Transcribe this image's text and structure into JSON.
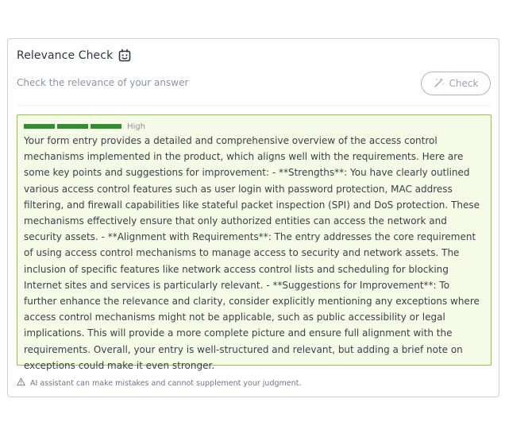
{
  "panel": {
    "title": "Relevance Check",
    "subtitle": "Check the relevance of your answer",
    "check_button_label": "Check"
  },
  "result": {
    "relevance_level": "High",
    "meter": {
      "filled_segments": 3,
      "total_segments": 3,
      "color": "#2f8f2f"
    },
    "text": "Your form entry provides a detailed and comprehensive overview of the access control mechanisms implemented in the product, which aligns well with the requirements. Here are some key points and suggestions for improvement: - **Strengths**: You have clearly outlined various access control features such as user login with password protection, MAC address filtering, and firewall capabilities like stateful packet inspection (SPI) and DoS protection. These mechanisms effectively ensure that only authorized entities can access the network and security assets. - **Alignment with Requirements**: The entry addresses the core requirement of using access control mechanisms to manage access to security and network assets. The inclusion of specific features like network access control lists and scheduling for blocking Internet sites and services is particularly relevant. - **Suggestions for Improvement**: To further enhance the relevance and clarity, consider explicitly mentioning any exceptions where access control mechanisms might not be applicable, such as public accessibility or legal implications. This will provide a more complete picture and ensure full alignment with the requirements. Overall, your entry is well-structured and relevant, but adding a brief note on exceptions could make it even stronger."
  },
  "disclaimer": "AI assistant can make mistakes and cannot supplement your judgment.",
  "icons": {
    "title_icon": "robot-icon",
    "button_icon": "magic-wand-icon",
    "disclaimer_icon": "warning-icon"
  },
  "colors": {
    "result_background": "#f5fbe6",
    "result_border": "#93c73a",
    "meter_fill": "#2f8f2f"
  }
}
